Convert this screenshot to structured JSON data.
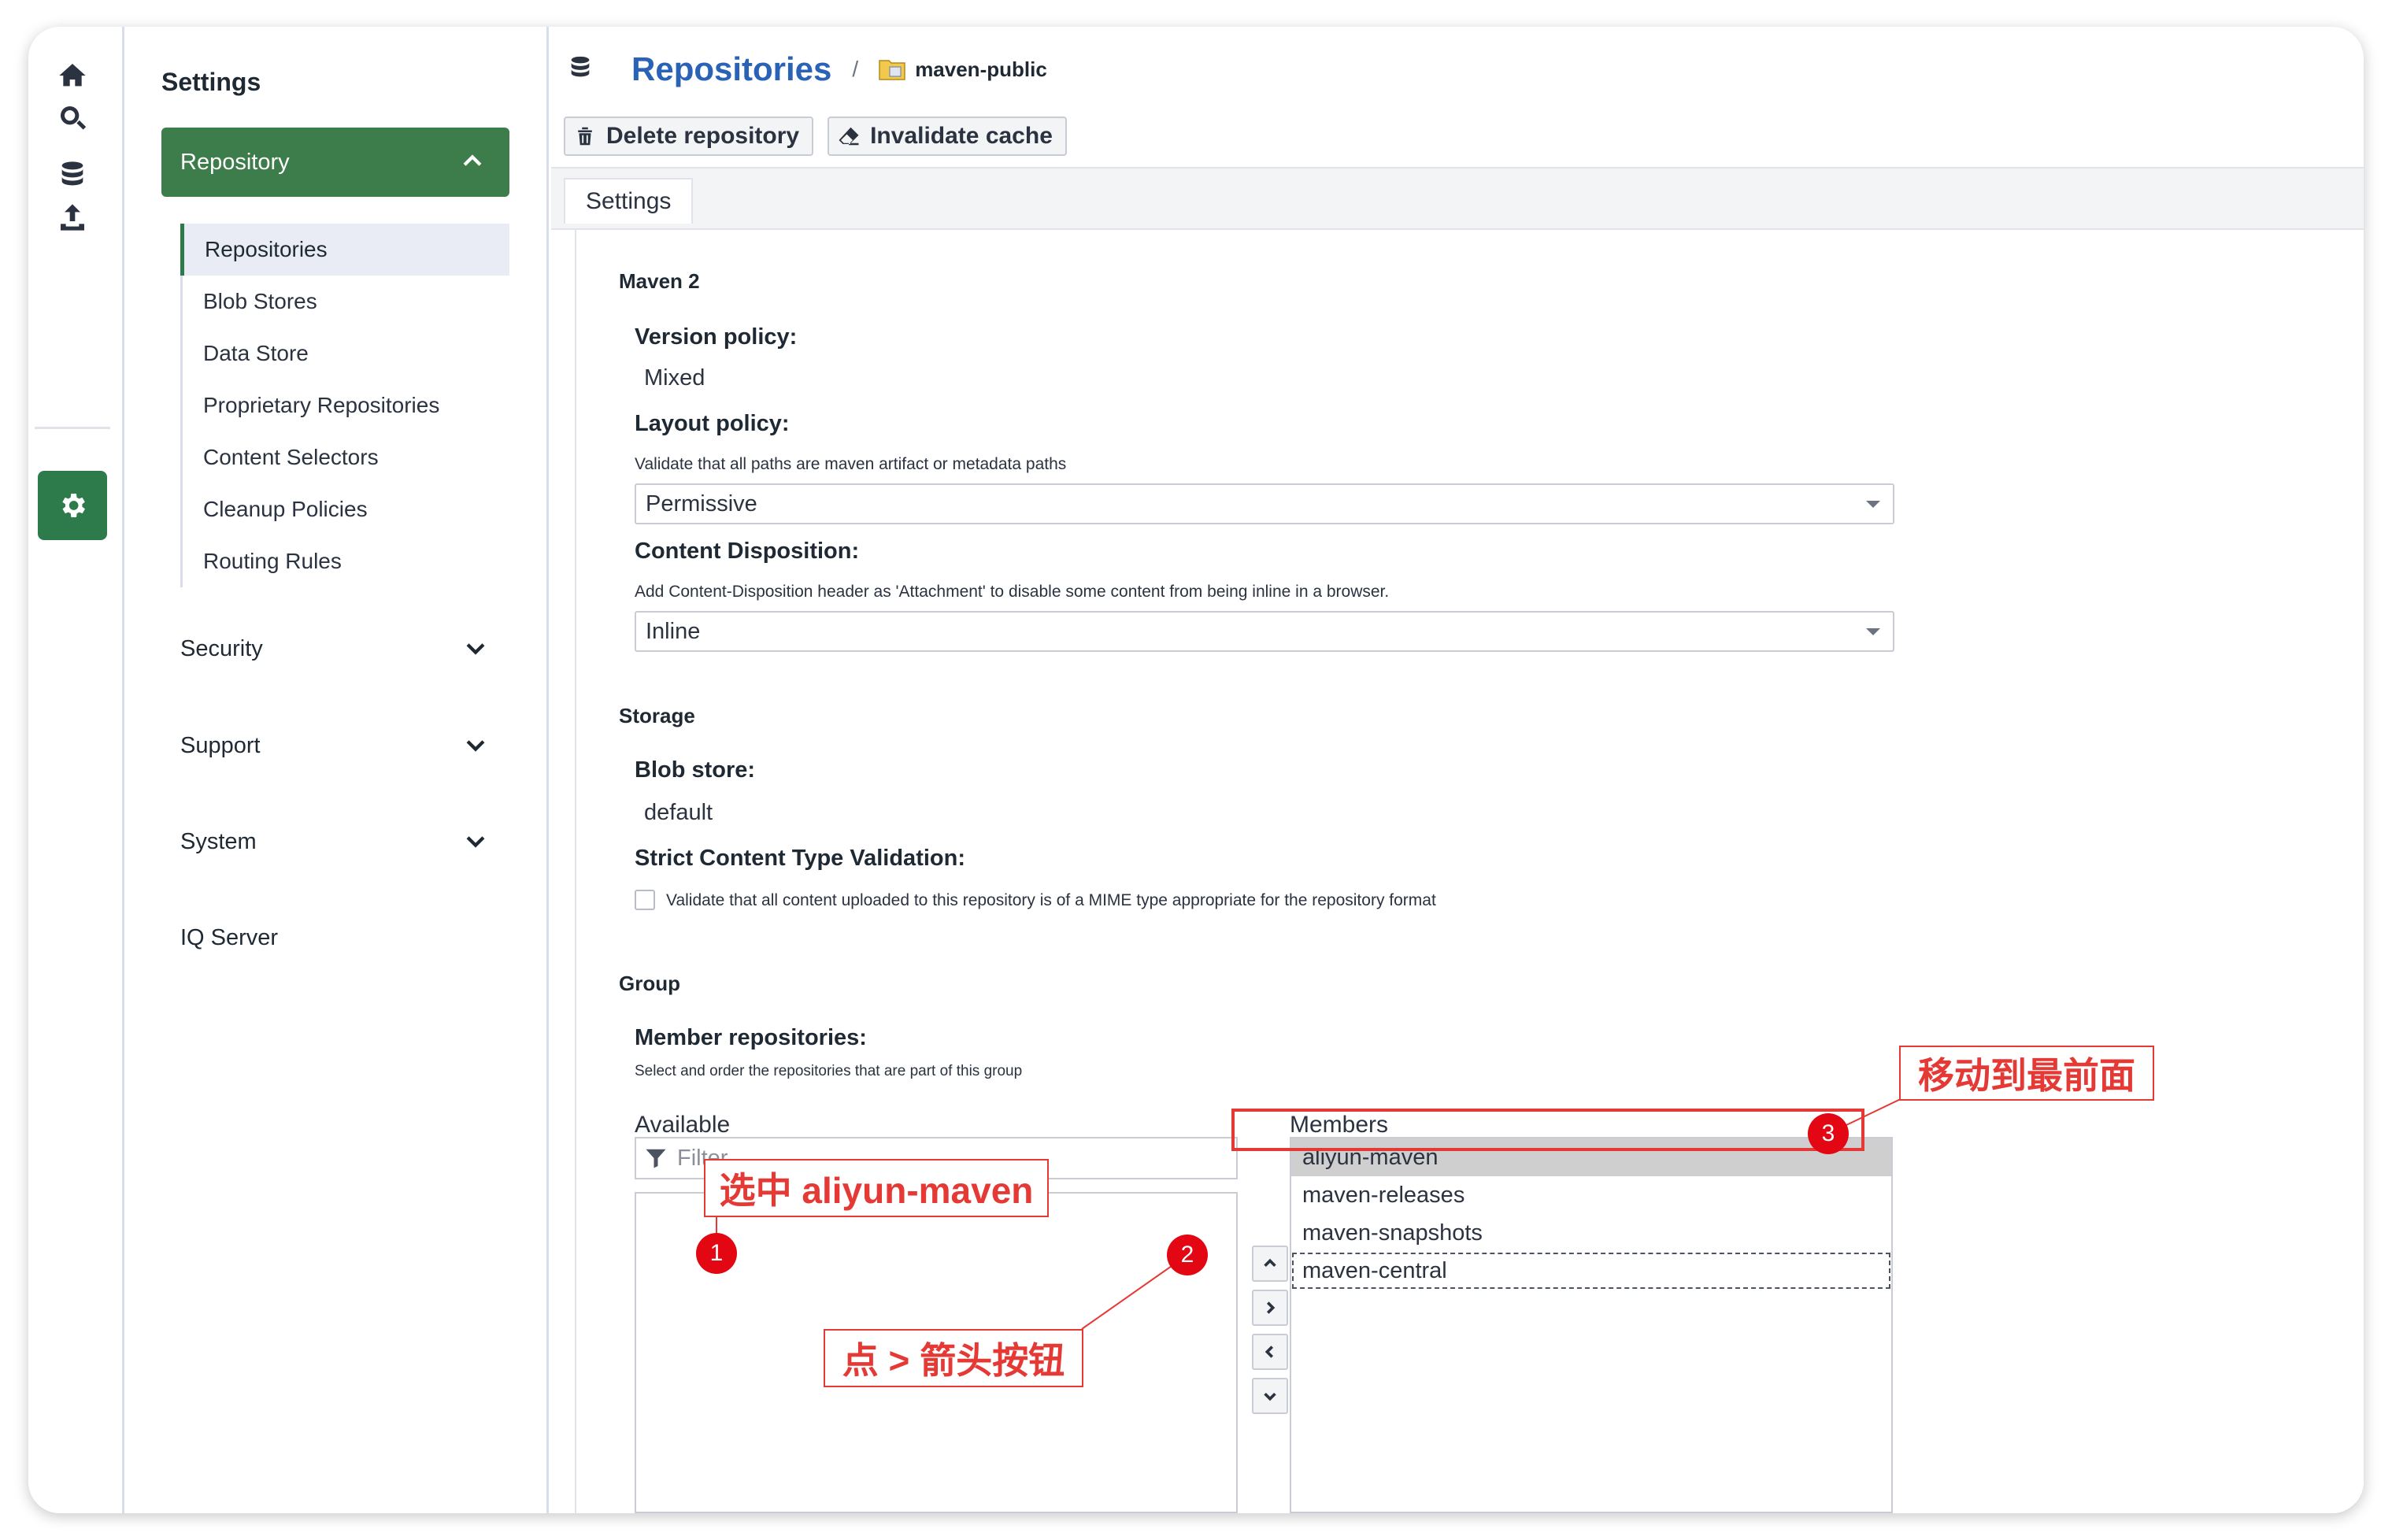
{
  "rail": {
    "items": [
      {
        "name": "home-icon"
      },
      {
        "name": "search-icon"
      },
      {
        "name": "database-icon"
      },
      {
        "name": "upload-icon"
      },
      {
        "name": "gear-icon"
      }
    ]
  },
  "sidebar": {
    "title": "Settings",
    "repository_header": "Repository",
    "sub_items": [
      "Repositories",
      "Blob Stores",
      "Data Store",
      "Proprietary Repositories",
      "Content Selectors",
      "Cleanup Policies",
      "Routing Rules"
    ],
    "active_sub_item": "Repositories",
    "sections": [
      "Security",
      "Support",
      "System",
      "IQ Server"
    ]
  },
  "breadcrumb": {
    "title": "Repositories",
    "separator": "/",
    "current": "maven-public"
  },
  "toolbar": {
    "delete_label": "Delete repository",
    "invalidate_label": "Invalidate cache"
  },
  "tabs": {
    "settings": "Settings"
  },
  "form": {
    "maven_section": "Maven 2",
    "version_policy_label": "Version policy:",
    "version_policy_value": "Mixed",
    "layout_policy_label": "Layout policy:",
    "layout_policy_help": "Validate that all paths are maven artifact or metadata paths",
    "layout_policy_value": "Permissive",
    "content_disposition_label": "Content Disposition:",
    "content_disposition_help": "Add Content-Disposition header as 'Attachment' to disable some content from being inline in a browser.",
    "content_disposition_value": "Inline",
    "storage_section": "Storage",
    "blob_store_label": "Blob store:",
    "blob_store_value": "default",
    "strict_label": "Strict Content Type Validation:",
    "strict_help": "Validate that all content uploaded to this repository is of a MIME type appropriate for the repository format",
    "strict_checked": false,
    "group_section": "Group",
    "member_label": "Member repositories:",
    "member_help": "Select and order the repositories that are part of this group",
    "available_label": "Available",
    "filter_placeholder": "Filter",
    "members_label": "Members",
    "members": [
      "aliyun-maven",
      "maven-releases",
      "maven-snapshots",
      "maven-central"
    ],
    "selected_member": "aliyun-maven",
    "focused_member": "maven-central"
  },
  "annotations": {
    "step1_text": "选中 aliyun-maven",
    "step2_text": "点 > 箭头按钮",
    "step3_text": "移动到最前面",
    "n1": "1",
    "n2": "2",
    "n3": "3"
  },
  "colors": {
    "accent_green": "#3d7c4b",
    "link_blue": "#2a62b6",
    "annotation_red": "#e53935"
  }
}
